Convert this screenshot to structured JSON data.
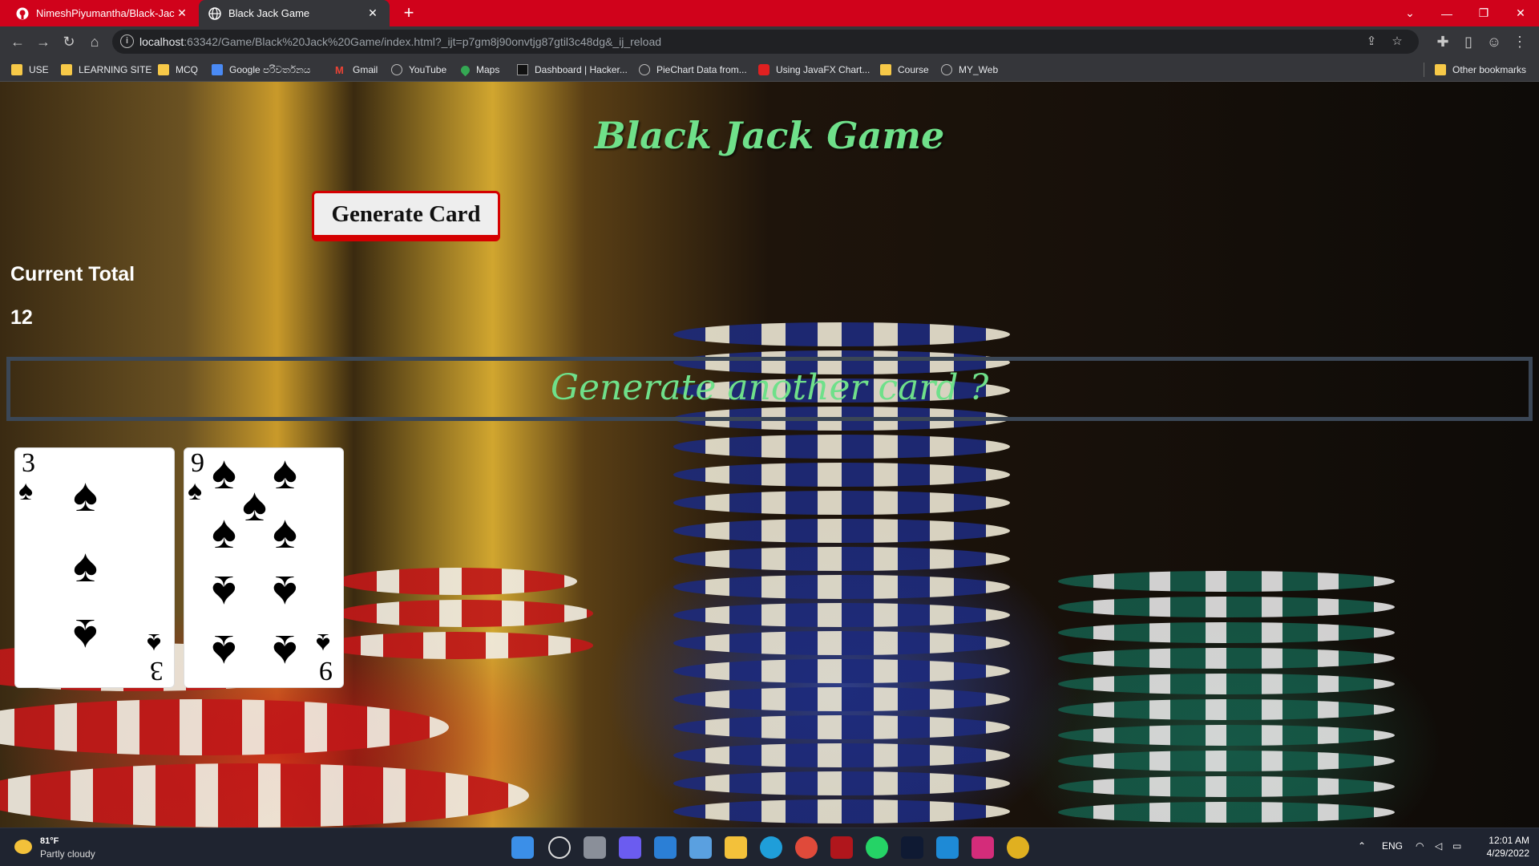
{
  "browser": {
    "tabs": [
      {
        "title": "NimeshPiyumantha/Black-Jack-G",
        "close": "✕"
      },
      {
        "title": "Black Jack Game",
        "close": "✕"
      }
    ],
    "new_tab": "+",
    "window_controls": {
      "min": "—",
      "max": "❐",
      "close": "✕",
      "dropdown": "⌄"
    },
    "nav": {
      "back": "←",
      "forward": "→",
      "reload": "↻",
      "home": "⌂"
    },
    "url_host": "localhost",
    "url_rest": ":63342/Game/Black%20Jack%20Game/index.html?_ijt=p7gm8j90onvtjg87gtil3c48dg&_ij_reload",
    "bookmarks": [
      "USE",
      "LEARNING SITE",
      "MCQ",
      "Google පරිවර්තනය",
      "Gmail",
      "YouTube",
      "Maps",
      "Dashboard | Hacker...",
      "PieChart Data from...",
      "Using JavaFX Chart...",
      "Course",
      "MY_Web"
    ],
    "other_bookmarks": "Other bookmarks"
  },
  "game": {
    "title": "Black Jack Game",
    "generate_button": "Generate Card",
    "total_label": "Current Total",
    "total_value": "12",
    "prompt": "Generate another card ?",
    "cards": [
      {
        "rank": "3",
        "suit": "♠"
      },
      {
        "rank": "9",
        "suit": "♠"
      }
    ]
  },
  "taskbar": {
    "temperature": "81°F",
    "weather": "Partly cloudy",
    "language": "ENG",
    "time": "12:01 AM",
    "date": "4/29/2022"
  },
  "colors": {
    "tabbar": "#d0021b",
    "title_green": "#6fe08a",
    "button_border": "#d40000"
  }
}
